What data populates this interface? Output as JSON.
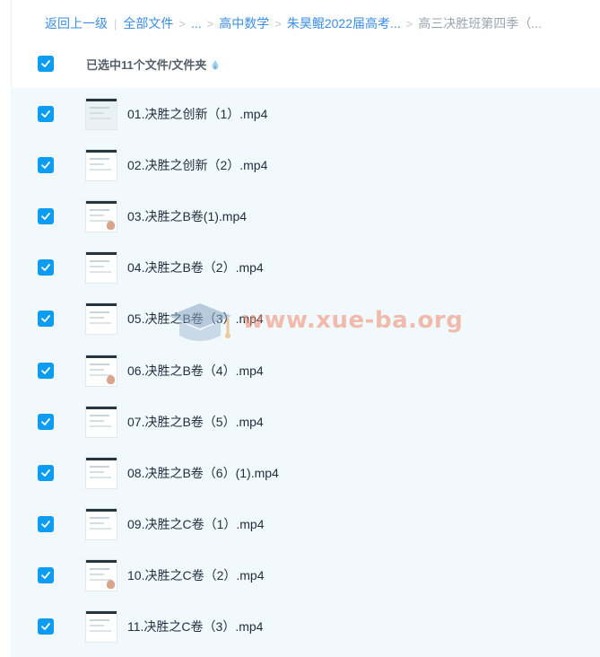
{
  "breadcrumb": {
    "back": "返回上一级",
    "all_files": "全部文件",
    "ellipsis": "...",
    "level1": "高中数学",
    "level2": "朱昊鲲2022届高考...",
    "current": "高三决胜班第四季（..."
  },
  "selection": {
    "label": "已选中11个文件/文件夹",
    "all_checked": true
  },
  "files": [
    {
      "name": "01.决胜之创新（1）.mp4",
      "checked": true
    },
    {
      "name": "02.决胜之创新（2）.mp4",
      "checked": true
    },
    {
      "name": "03.决胜之B卷(1).mp4",
      "checked": true
    },
    {
      "name": "04.决胜之B卷（2）.mp4",
      "checked": true
    },
    {
      "name": "05.决胜之B卷（3）.mp4",
      "checked": true
    },
    {
      "name": "06.决胜之B卷（4）.mp4",
      "checked": true
    },
    {
      "name": "07.决胜之B卷（5）.mp4",
      "checked": true
    },
    {
      "name": "08.决胜之B卷（6）(1).mp4",
      "checked": true
    },
    {
      "name": "09.决胜之C卷（1）.mp4",
      "checked": true
    },
    {
      "name": "10.决胜之C卷（2）.mp4",
      "checked": true
    },
    {
      "name": "11.决胜之C卷（3）.mp4",
      "checked": true
    }
  ],
  "watermark": {
    "text": "www.xue-ba.org"
  },
  "colors": {
    "accent": "#0c9cf2",
    "link": "#3a8ee6",
    "list_bg": "#f2f9fd"
  }
}
